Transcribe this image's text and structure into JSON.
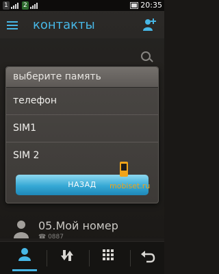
{
  "status": {
    "sim1": "1",
    "sim2": "2",
    "time": "20:35"
  },
  "header": {
    "title": "контакты"
  },
  "list": {
    "visible_contact_name": "05.Мой номер",
    "visible_contact_sub": "☎ 0887"
  },
  "dialog": {
    "title": "выберите память",
    "options": [
      "телефон",
      "SIM1",
      "SIM 2"
    ],
    "button": "НАЗАД"
  },
  "watermark": "mobiset.ru",
  "icons": [
    "menu-icon",
    "add-contact-icon",
    "search-icon",
    "contacts-icon",
    "call-log-icon",
    "dialpad-icon",
    "back-icon"
  ],
  "colors": {
    "accent": "#47b7e6",
    "dialog_button": "#35a8d5",
    "watermark": "#f0a41a"
  }
}
